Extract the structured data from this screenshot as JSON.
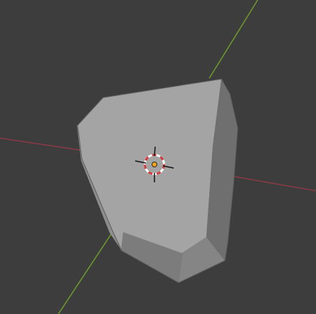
{
  "viewport": {
    "background": "#3d3d3d"
  },
  "axes": {
    "x_axis_color": "#8b3a48",
    "y_axis_color": "#6f9a2c"
  },
  "mesh": {
    "object": "mesh-object",
    "top_face_color": "#a4a4a4",
    "left_face_color": "#8e8e8e",
    "right_face_color": "#6f6f6f",
    "bottom_right_face_color": "#858585",
    "bottom_inner_face_color": "#7c7c7c",
    "left_under_face_color": "#7f7f7f"
  },
  "cursor": {
    "icon": "3d-cursor-icon",
    "ring_red": "#d13b3b",
    "ring_white": "#ffffff",
    "crosshair_color": "#111111"
  },
  "origin": {
    "icon": "object-origin-icon",
    "fill": "#f2a31b",
    "stroke": "#2a2a2a"
  }
}
